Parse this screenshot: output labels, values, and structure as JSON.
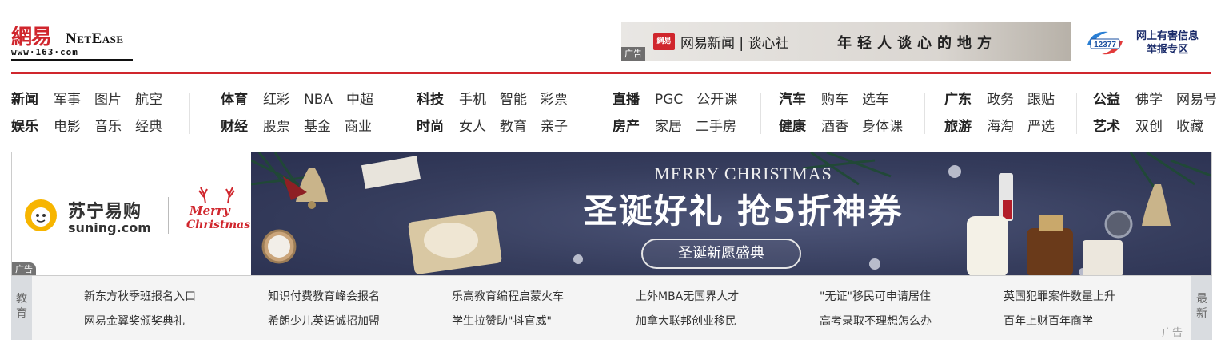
{
  "header": {
    "logo": {
      "cn": "網易",
      "en": "NetEase",
      "url": "www·163·com"
    },
    "top_ad": {
      "badge": "網易",
      "brand": "网易新闻 | 谈心社",
      "slogan": "年轻人谈心的地方",
      "ad_label": "广告"
    },
    "report": {
      "line1": "网上有害信息",
      "line2": "举报专区",
      "emblem_text": "12377"
    }
  },
  "nav": {
    "groups": [
      {
        "rows": [
          [
            "新闻",
            "军事",
            "图片",
            "航空"
          ],
          [
            "娱乐",
            "电影",
            "音乐",
            "经典"
          ]
        ]
      },
      {
        "rows": [
          [
            "体育",
            "红彩",
            "NBA",
            "中超"
          ],
          [
            "财经",
            "股票",
            "基金",
            "商业"
          ]
        ]
      },
      {
        "rows": [
          [
            "科技",
            "手机",
            "智能",
            "彩票"
          ],
          [
            "时尚",
            "女人",
            "教育",
            "亲子"
          ]
        ]
      },
      {
        "rows": [
          [
            "直播",
            "PGC",
            "公开课"
          ],
          [
            "房产",
            "家居",
            "二手房"
          ]
        ]
      },
      {
        "rows": [
          [
            "汽车",
            "购车",
            "选车"
          ],
          [
            "健康",
            "酒香",
            "身体课"
          ]
        ]
      },
      {
        "rows": [
          [
            "广东",
            "政务",
            "跟贴"
          ],
          [
            "旅游",
            "海淘",
            "严选"
          ]
        ]
      },
      {
        "rows": [
          [
            "公益",
            "佛学",
            "网易号"
          ],
          [
            "艺术",
            "双创",
            "收藏"
          ]
        ]
      }
    ]
  },
  "banner": {
    "suning_cn": "苏宁易购",
    "suning_en": "suning.com",
    "merry1": "Merry",
    "merry2": "Christmas",
    "headline_en": "MERRY CHRISTMAS",
    "headline_cn": "圣诞好礼 抢5折神券",
    "button": "圣诞新愿盛典",
    "ad_label": "广告"
  },
  "ticker": {
    "left_tab": "教育",
    "right_tab": "最新",
    "ad_label": "广告",
    "row1": [
      "新东方秋季班报名入口",
      "知识付费教育峰会报名",
      "乐高教育编程启蒙火车",
      "上外MBA无国界人才",
      "\"无证\"移民可申请居住",
      "英国犯罪案件数量上升"
    ],
    "row2": [
      "网易金翼奖颁奖典礼",
      "希朗少儿英语诚招加盟",
      "学生拉赞助\"抖官威\"",
      "加拿大联邦创业移民",
      "高考录取不理想怎么办",
      "百年上财百年商学"
    ]
  },
  "colors": {
    "brand_red": "#d0262d",
    "banner_bg": "#363d5d",
    "ticker_bg": "#f4f4f4"
  }
}
